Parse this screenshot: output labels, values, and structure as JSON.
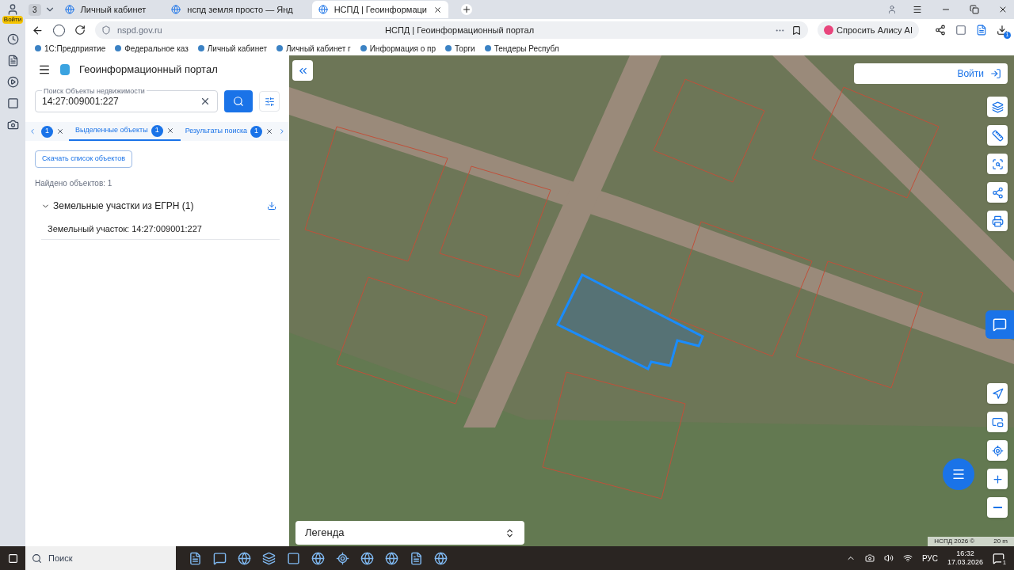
{
  "browser": {
    "profile_badge": "Войти",
    "tab_count": "3",
    "tabs": [
      {
        "label": "Личный кабинет",
        "selected": false
      },
      {
        "label": "нспд земля просто — Янд",
        "selected": false
      },
      {
        "label": "НСПД | Геоинформаци",
        "selected": true
      }
    ],
    "address": "nspd.gov.ru",
    "page_title": "НСПД | Геоинформационный портал",
    "alice_button": "Спросить Алису AI",
    "download_count": "1",
    "bookmarks": [
      "1С:Предприятие",
      "Федеральное каз",
      "Личный кабинет",
      "Личный кабинет г",
      "Информация о пр",
      "Торги",
      "Тендеры Республ"
    ]
  },
  "portal": {
    "title": "Геоинформационный портал",
    "search": {
      "label": "Поиск Объекты недвижимости",
      "value": "14:27:009001:227"
    },
    "result_tabs": [
      {
        "count": "1",
        "selected": false
      },
      {
        "label": "Выделенные объекты",
        "count": "1",
        "selected": true
      },
      {
        "label": "Результаты поиска",
        "count": "1",
        "selected": false
      }
    ],
    "download_list_button": "Скачать список объектов",
    "found": "Найдено объектов: 1",
    "group": {
      "label": "Земельные участки из ЕГРН (1)",
      "expanded": true,
      "items": [
        "Земельный участок: 14:27:009001:227"
      ]
    }
  },
  "map": {
    "login_button": "Войти",
    "legend": "Легенда",
    "attribution": "НСПД 2026 ©",
    "scale": "20 m"
  },
  "taskbar": {
    "search_placeholder": "Поиск",
    "language": "РУС",
    "time": "16:32",
    "date": "17.03.2026",
    "notification_count": "1"
  }
}
